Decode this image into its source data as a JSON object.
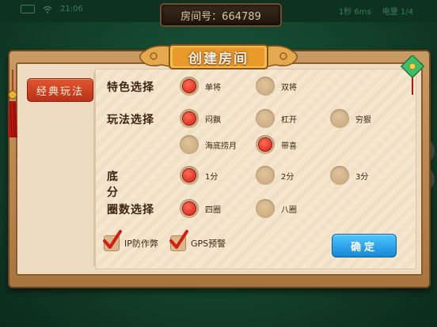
{
  "status": {
    "time": "21:06",
    "signal": "1秒 6ms",
    "battery": "电量 1/4"
  },
  "room": {
    "label": "房间号：664789"
  },
  "dialog": {
    "title": "创建房间",
    "tab": "经典玩法",
    "rows": [
      {
        "label": "特色选择",
        "options": [
          {
            "text": "单将",
            "selected": true
          },
          {
            "text": "双将",
            "selected": false
          }
        ]
      },
      {
        "label": "玩法选择",
        "options": [
          {
            "text": "闷飘",
            "selected": true
          },
          {
            "text": "杠开",
            "selected": false
          },
          {
            "text": "穷狠",
            "selected": false
          },
          {
            "text": "海底捞月",
            "selected": false
          },
          {
            "text": "带喜",
            "selected": true
          }
        ]
      },
      {
        "label": "底分",
        "options": [
          {
            "text": "1分",
            "selected": true
          },
          {
            "text": "2分",
            "selected": false
          },
          {
            "text": "3分",
            "selected": false
          }
        ]
      },
      {
        "label": "圈数选择",
        "options": [
          {
            "text": "四圈",
            "selected": true
          },
          {
            "text": "八圈",
            "selected": false
          }
        ]
      }
    ],
    "checks": [
      {
        "text": "IP防作弊",
        "checked": true
      },
      {
        "text": "GPS预警",
        "checked": true
      }
    ],
    "confirm": "确定"
  },
  "colors": {
    "accent_red": "#d41e14",
    "confirm_blue": "#1687d6",
    "table_green": "#1c5a3c"
  }
}
